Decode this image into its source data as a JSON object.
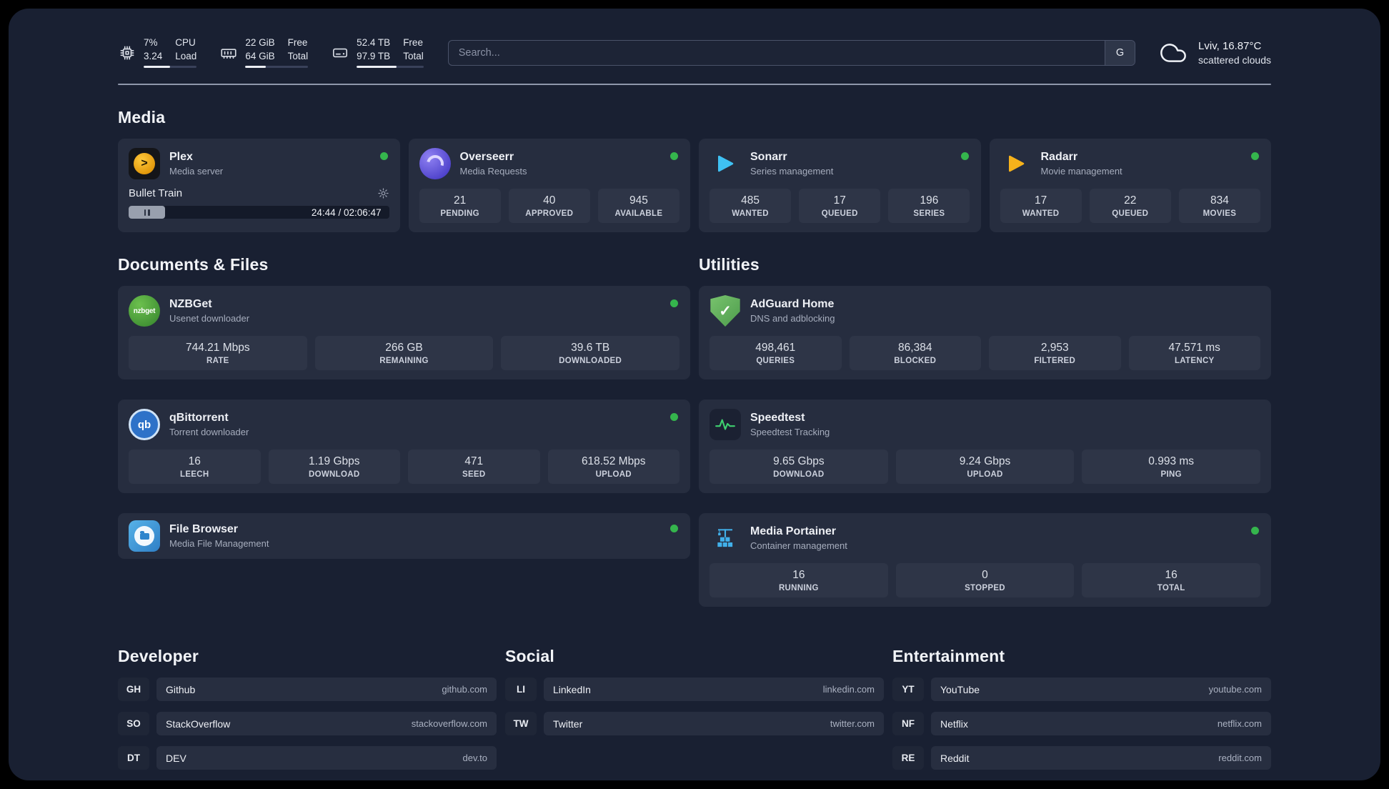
{
  "header": {
    "cpu": {
      "icon": "cpu-icon",
      "value": "7%",
      "load": "3.24",
      "label1": "CPU",
      "label2": "Load",
      "bar": 0.5
    },
    "memory": {
      "icon": "memory-icon",
      "free": "22 GiB",
      "total": "64 GiB",
      "label1": "Free",
      "label2": "Total",
      "bar": 0.33
    },
    "disk": {
      "icon": "disk-icon",
      "free": "52.4 TB",
      "total": "97.9 TB",
      "label1": "Free",
      "label2": "Total",
      "bar": 0.6
    },
    "search": {
      "placeholder": "Search...",
      "button_label": "G"
    },
    "weather": {
      "icon": "cloud-icon",
      "location": "Lviv, 16.87°C",
      "condition": "scattered clouds"
    }
  },
  "media": {
    "title": "Media",
    "plex": {
      "icon": "plex-icon",
      "name": "Plex",
      "subtitle": "Media server",
      "now_playing": "Bullet Train",
      "time": "24:44 / 02:06:47",
      "progress": 0.14
    },
    "overseerr": {
      "icon": "overseerr-icon",
      "name": "Overseerr",
      "subtitle": "Media Requests",
      "stats": [
        {
          "value": "21",
          "label": "PENDING"
        },
        {
          "value": "40",
          "label": "APPROVED"
        },
        {
          "value": "945",
          "label": "AVAILABLE"
        }
      ]
    },
    "sonarr": {
      "icon": "sonarr-icon",
      "name": "Sonarr",
      "subtitle": "Series management",
      "stats": [
        {
          "value": "485",
          "label": "WANTED"
        },
        {
          "value": "17",
          "label": "QUEUED"
        },
        {
          "value": "196",
          "label": "SERIES"
        }
      ]
    },
    "radarr": {
      "icon": "radarr-icon",
      "name": "Radarr",
      "subtitle": "Movie management",
      "stats": [
        {
          "value": "17",
          "label": "WANTED"
        },
        {
          "value": "22",
          "label": "QUEUED"
        },
        {
          "value": "834",
          "label": "MOVIES"
        }
      ]
    }
  },
  "documents": {
    "title": "Documents & Files",
    "nzbget": {
      "icon": "nzbget-icon",
      "name": "NZBGet",
      "subtitle": "Usenet downloader",
      "icon_text": "nzbget",
      "stats": [
        {
          "value": "744.21 Mbps",
          "label": "RATE"
        },
        {
          "value": "266 GB",
          "label": "REMAINING"
        },
        {
          "value": "39.6 TB",
          "label": "DOWNLOADED"
        }
      ]
    },
    "qbittorrent": {
      "icon": "qbittorrent-icon",
      "name": "qBittorrent",
      "subtitle": "Torrent downloader",
      "icon_text": "qb",
      "stats": [
        {
          "value": "16",
          "label": "LEECH"
        },
        {
          "value": "1.19 Gbps",
          "label": "DOWNLOAD"
        },
        {
          "value": "471",
          "label": "SEED"
        },
        {
          "value": "618.52 Mbps",
          "label": "UPLOAD"
        }
      ]
    },
    "filebrowser": {
      "icon": "filebrowser-icon",
      "name": "File Browser",
      "subtitle": "Media File Management"
    }
  },
  "utilities": {
    "title": "Utilities",
    "adguard": {
      "icon": "adguard-shield-icon",
      "name": "AdGuard Home",
      "subtitle": "DNS and adblocking",
      "icon_glyph": "✓",
      "stats": [
        {
          "value": "498,461",
          "label": "QUERIES"
        },
        {
          "value": "86,384",
          "label": "BLOCKED"
        },
        {
          "value": "2,953",
          "label": "FILTERED"
        },
        {
          "value": "47.571 ms",
          "label": "LATENCY"
        }
      ]
    },
    "speedtest": {
      "icon": "speedtest-graph-icon",
      "name": "Speedtest",
      "subtitle": "Speedtest Tracking",
      "stats": [
        {
          "value": "9.65 Gbps",
          "label": "DOWNLOAD"
        },
        {
          "value": "9.24 Gbps",
          "label": "UPLOAD"
        },
        {
          "value": "0.993 ms",
          "label": "PING"
        }
      ]
    },
    "portainer": {
      "icon": "portainer-crane-icon",
      "name": "Media Portainer",
      "subtitle": "Container management",
      "stats": [
        {
          "value": "16",
          "label": "RUNNING"
        },
        {
          "value": "0",
          "label": "STOPPED"
        },
        {
          "value": "16",
          "label": "TOTAL"
        }
      ]
    }
  },
  "links": {
    "developer": {
      "title": "Developer",
      "items": [
        {
          "badge": "GH",
          "name": "Github",
          "url": "github.com"
        },
        {
          "badge": "SO",
          "name": "StackOverflow",
          "url": "stackoverflow.com"
        },
        {
          "badge": "DT",
          "name": "DEV",
          "url": "dev.to"
        }
      ]
    },
    "social": {
      "title": "Social",
      "items": [
        {
          "badge": "LI",
          "name": "LinkedIn",
          "url": "linkedin.com"
        },
        {
          "badge": "TW",
          "name": "Twitter",
          "url": "twitter.com"
        }
      ]
    },
    "entertainment": {
      "title": "Entertainment",
      "items": [
        {
          "badge": "YT",
          "name": "YouTube",
          "url": "youtube.com"
        },
        {
          "badge": "NF",
          "name": "Netflix",
          "url": "netflix.com"
        },
        {
          "badge": "RE",
          "name": "Reddit",
          "url": "reddit.com"
        }
      ]
    }
  },
  "colors": {
    "status_online": "#35b54d",
    "accent_graph_green": "#3ed06f"
  }
}
